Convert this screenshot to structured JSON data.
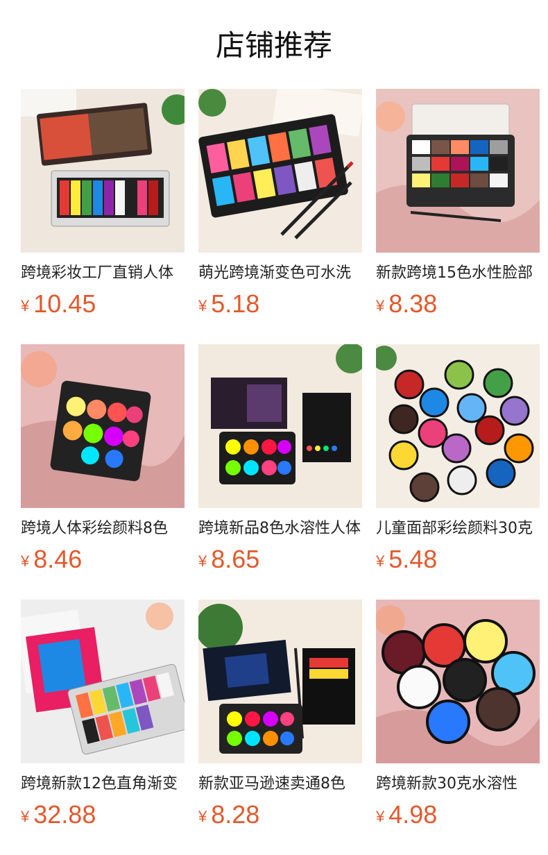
{
  "page": {
    "title": "店铺推荐"
  },
  "currency": "¥",
  "products": [
    {
      "name": "跨境彩妆工厂直销人体",
      "price": "10.45",
      "image": "face-paint-palette-12-water-based"
    },
    {
      "name": "萌光跨境渐变色可水洗",
      "price": "5.18",
      "image": "split-cake-rainbow-palette-with-brushes"
    },
    {
      "name": "新款跨境15色水性脸部",
      "price": "8.38",
      "image": "15-color-face-paint-palette"
    },
    {
      "name": "跨境人体彩绘颜料8色",
      "price": "8.46",
      "image": "8-color-neon-palette"
    },
    {
      "name": "跨境新品8色水溶性人体",
      "price": "8.65",
      "image": "water-based-glow-paint-kit"
    },
    {
      "name": "儿童面部彩绘颜料30克",
      "price": "5.48",
      "image": "split-cake-rounds-set"
    },
    {
      "name": "跨境新款12色直角渐变",
      "price": "32.88",
      "image": "12-color-split-cake-palette-box"
    },
    {
      "name": "新款亚马逊速卖通8色",
      "price": "8.28",
      "image": "8-color-water-based-kit-with-brush"
    },
    {
      "name": "跨境新款30克水溶性",
      "price": "4.98",
      "image": "30g-solid-color-rounds"
    }
  ]
}
